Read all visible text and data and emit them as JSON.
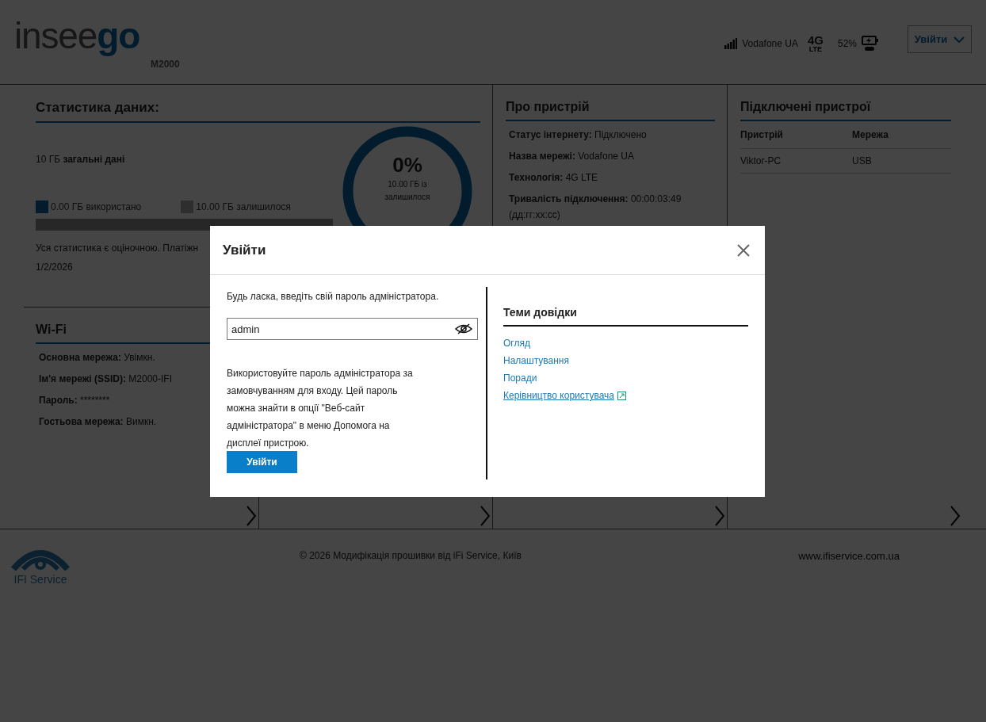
{
  "header": {
    "logo": {
      "light": "insee",
      "bold": "go",
      "model": "M2000"
    },
    "carrier": "Vodafone UA",
    "network": {
      "tech": "4G",
      "sub": "LTE"
    },
    "battery": "52%",
    "login_button": "Увійти"
  },
  "data_stats": {
    "title": "Статистика даних:",
    "total": "10 ГБ **загальні дані**",
    "legend": [
      {
        "label": "0.00 ГБ використано",
        "kind": "used"
      },
      {
        "label": "10.00 ГБ залишилося",
        "kind": "remaining"
      }
    ],
    "level": 0,
    "note": "Уся статистика є оціночною. Платіжн",
    "date": "1/2/2026",
    "gauge": {
      "percent": "0%",
      "caption": "10.00 ГБ із залишилося"
    }
  },
  "device": {
    "title": "Про пристрій",
    "rows": [
      {
        "label": "Статус інтернету:",
        "value": "Підключено"
      },
      {
        "label": "Назва мережі:",
        "value": "Vodafone UA"
      },
      {
        "label": "Технологія:",
        "value": "4G LTE"
      },
      {
        "label": "Тривалість підключення:",
        "value": "00:00:03:49 (дд:гг:хх:сс)"
      }
    ]
  },
  "connected": {
    "title": "Підключені пристрої",
    "columns": [
      "Пристрій",
      "Мережа"
    ],
    "rows": [
      [
        "Viktor-PC",
        "USB"
      ]
    ]
  },
  "wifi": {
    "title": "Wi-Fi",
    "rows": [
      {
        "label": "Основна мережа:",
        "value": "Увімкн."
      },
      {
        "label": "Ім'я мережі (SSID):",
        "value": "M2000-IFI"
      },
      {
        "label": "Пароль:",
        "value": "********"
      },
      {
        "label": "Гостьова мережа:",
        "value": "Вимкн."
      }
    ]
  },
  "footer": {
    "logo_text": "IFI Service",
    "copyright": "© 2026 Модифікація прошивки від iFi Service, Київ",
    "website": "www.ifiservice.com.ua"
  },
  "dialog": {
    "title": "Увійти",
    "prompt": "Будь ласка, введіть свій пароль адміністратора.",
    "password": {
      "value": "admin"
    },
    "hint": "Використовуйте пароль адміністратора за замовчуванням для входу. Цей пароль можна знайти в опції \"Веб-сайт адміністратора\" в меню Допомога на дисплеї пристрою.",
    "submit": "Увійти",
    "help": {
      "title": "Теми довідки",
      "links": [
        {
          "label": "Огляд",
          "external": false
        },
        {
          "label": "Налаштування",
          "external": false
        },
        {
          "label": "Поради",
          "external": false
        },
        {
          "label": "Керівництво користувача",
          "external": true
        }
      ]
    }
  }
}
